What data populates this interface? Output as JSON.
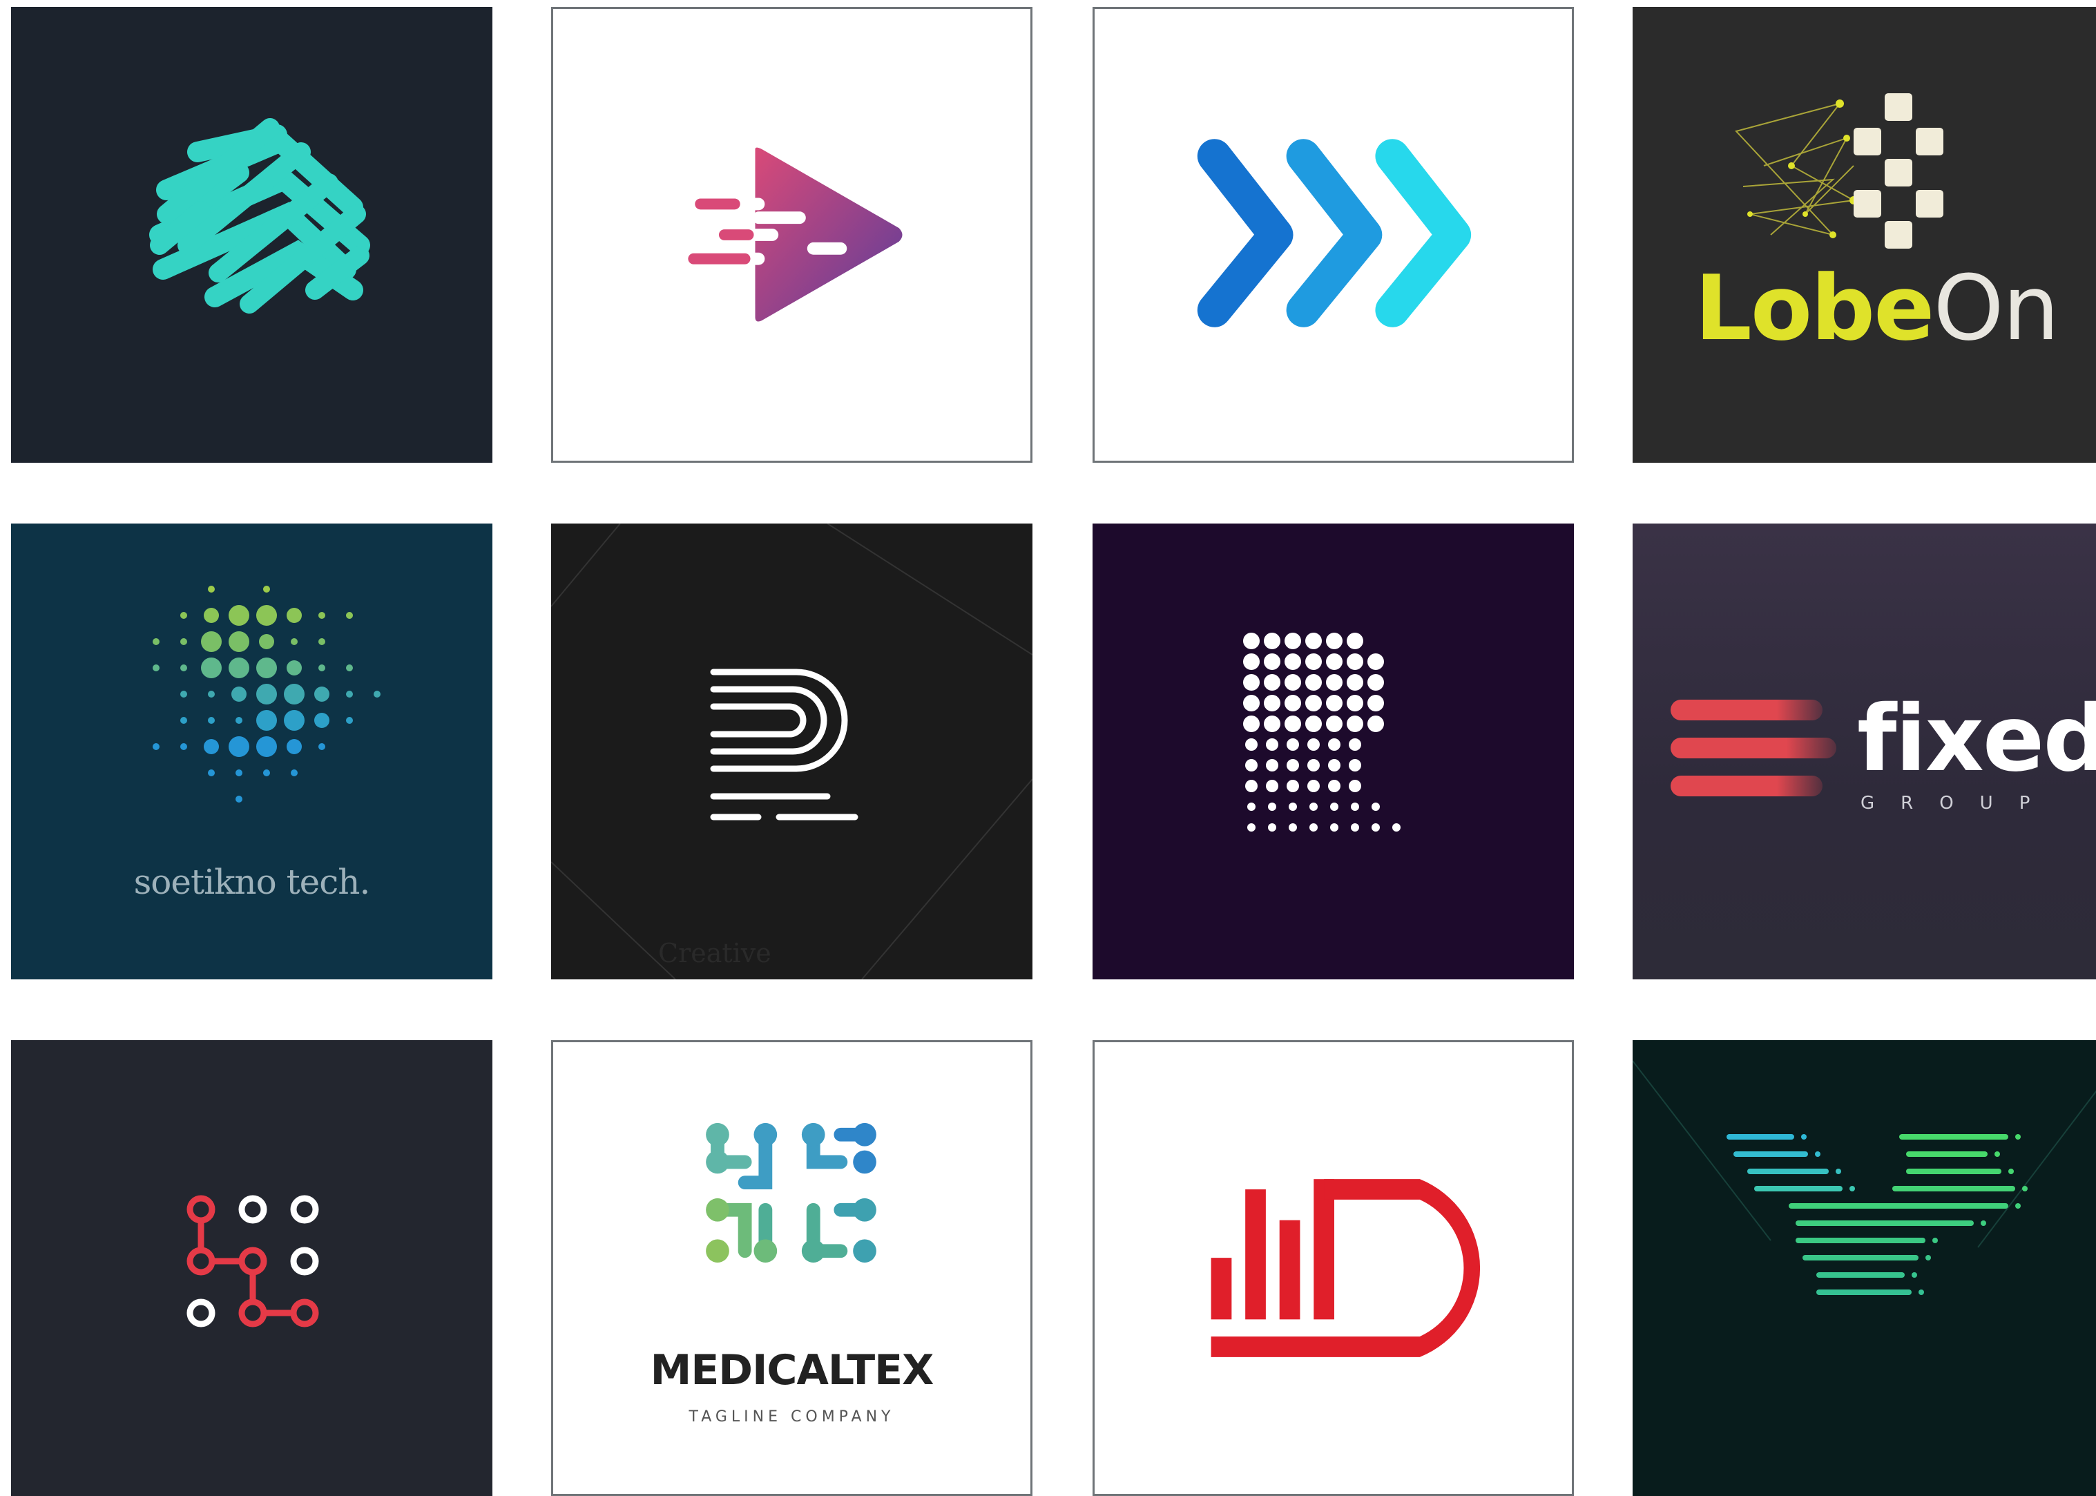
{
  "tiles": [
    {
      "id": 1,
      "icon": "diagonal-stripes-icon"
    },
    {
      "id": 2,
      "icon": "play-arrow-speed-icon"
    },
    {
      "id": 3,
      "icon": "triple-chevron-icon"
    },
    {
      "id": 4,
      "icon": "network-nodes-icon",
      "wordmark_a": "Lobe",
      "wordmark_b": "On"
    },
    {
      "id": 5,
      "icon": "dot-matrix-s-icon",
      "wordmark": "soetikno tech."
    },
    {
      "id": 6,
      "icon": "line-letter-r-icon",
      "watermark": "Creative"
    },
    {
      "id": 7,
      "icon": "dotted-letter-r-icon"
    },
    {
      "id": 8,
      "icon": "speed-bars-icon",
      "wordmark": "fixed",
      "sub": "GROUP"
    },
    {
      "id": 9,
      "icon": "circuit-circles-icon"
    },
    {
      "id": 10,
      "icon": "molecule-grid-icon",
      "wordmark": "MEDICALTEX",
      "tagline": "TAGLINE   COMPANY"
    },
    {
      "id": 11,
      "icon": "bar-chart-d-icon"
    },
    {
      "id": 12,
      "icon": "speed-lines-v-icon"
    }
  ],
  "colors": {
    "teal": "#35d3c4",
    "lobe_yellow": "#dfe22a",
    "fixed_red": "#e0474f",
    "id_red": "#e01f2a",
    "circuit_red": "#e53a47"
  }
}
